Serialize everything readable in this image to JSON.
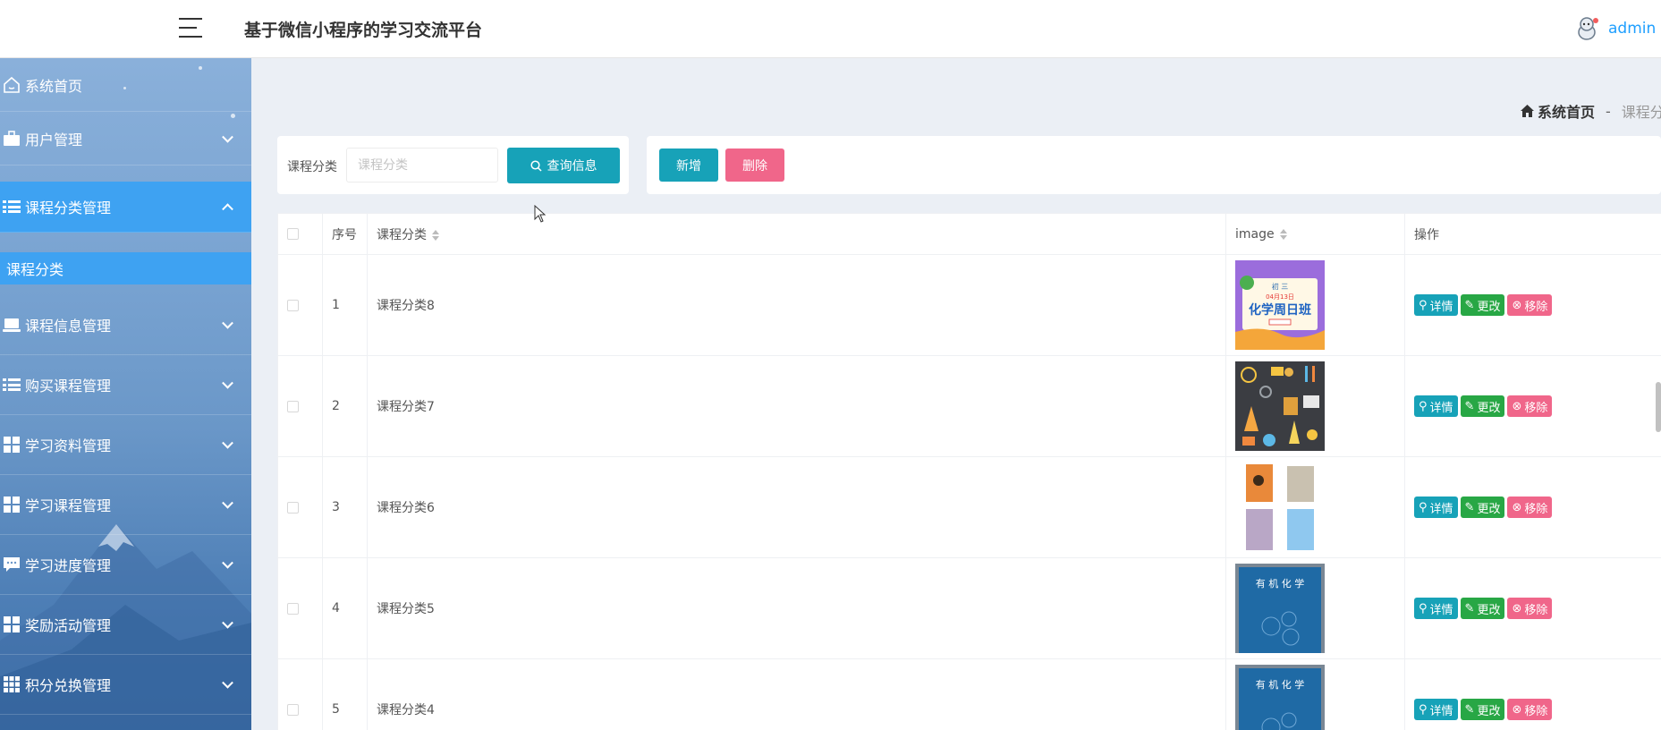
{
  "header": {
    "app_title": "基于微信小程序的学习交流平台",
    "username": "admin"
  },
  "sidebar": {
    "items": [
      {
        "label": "系统首页",
        "icon": "home-icon"
      },
      {
        "label": "用户管理",
        "icon": "briefcase-icon"
      },
      {
        "label": "课程分类管理",
        "icon": "list-icon",
        "expanded": true,
        "active": true
      },
      {
        "label": "课程信息管理",
        "icon": "laptop-icon"
      },
      {
        "label": "购买课程管理",
        "icon": "list-icon"
      },
      {
        "label": "学习资料管理",
        "icon": "grid-icon"
      },
      {
        "label": "学习课程管理",
        "icon": "grid-icon"
      },
      {
        "label": "学习进度管理",
        "icon": "comment-icon"
      },
      {
        "label": "奖励活动管理",
        "icon": "grid-icon"
      },
      {
        "label": "积分兑换管理",
        "icon": "apps-icon"
      }
    ],
    "sub_item": "课程分类"
  },
  "breadcrumb": {
    "home": "系统首页",
    "separator": "-",
    "current": "课程分类"
  },
  "search": {
    "label": "课程分类",
    "placeholder": "课程分类",
    "value": "",
    "button": "查询信息"
  },
  "actions": {
    "add": "新增",
    "delete": "删除"
  },
  "table": {
    "headers": {
      "index": "序号",
      "category": "课程分类",
      "image": "image",
      "ops": "操作"
    },
    "rows": [
      {
        "index": "1",
        "category": "课程分类8"
      },
      {
        "index": "2",
        "category": "课程分类7"
      },
      {
        "index": "3",
        "category": "课程分类6"
      },
      {
        "index": "4",
        "category": "课程分类5"
      },
      {
        "index": "5",
        "category": "课程分类4"
      }
    ],
    "row_buttons": {
      "detail": "详情",
      "edit": "更改",
      "remove": "移除"
    }
  },
  "colors": {
    "sidebar_active": "#3ea2f2",
    "primary_btn": "#17a2b8",
    "edit_btn": "#28a745",
    "danger_btn": "#f0668a",
    "link": "#1e9fff"
  },
  "thumb_text": {
    "row1_line1": "初 三",
    "row1_line2": "04月13日",
    "row1_line3": "化学周日班",
    "row4_line1": "有 机 化 学",
    "row5_line1": "有 机 化 学"
  }
}
